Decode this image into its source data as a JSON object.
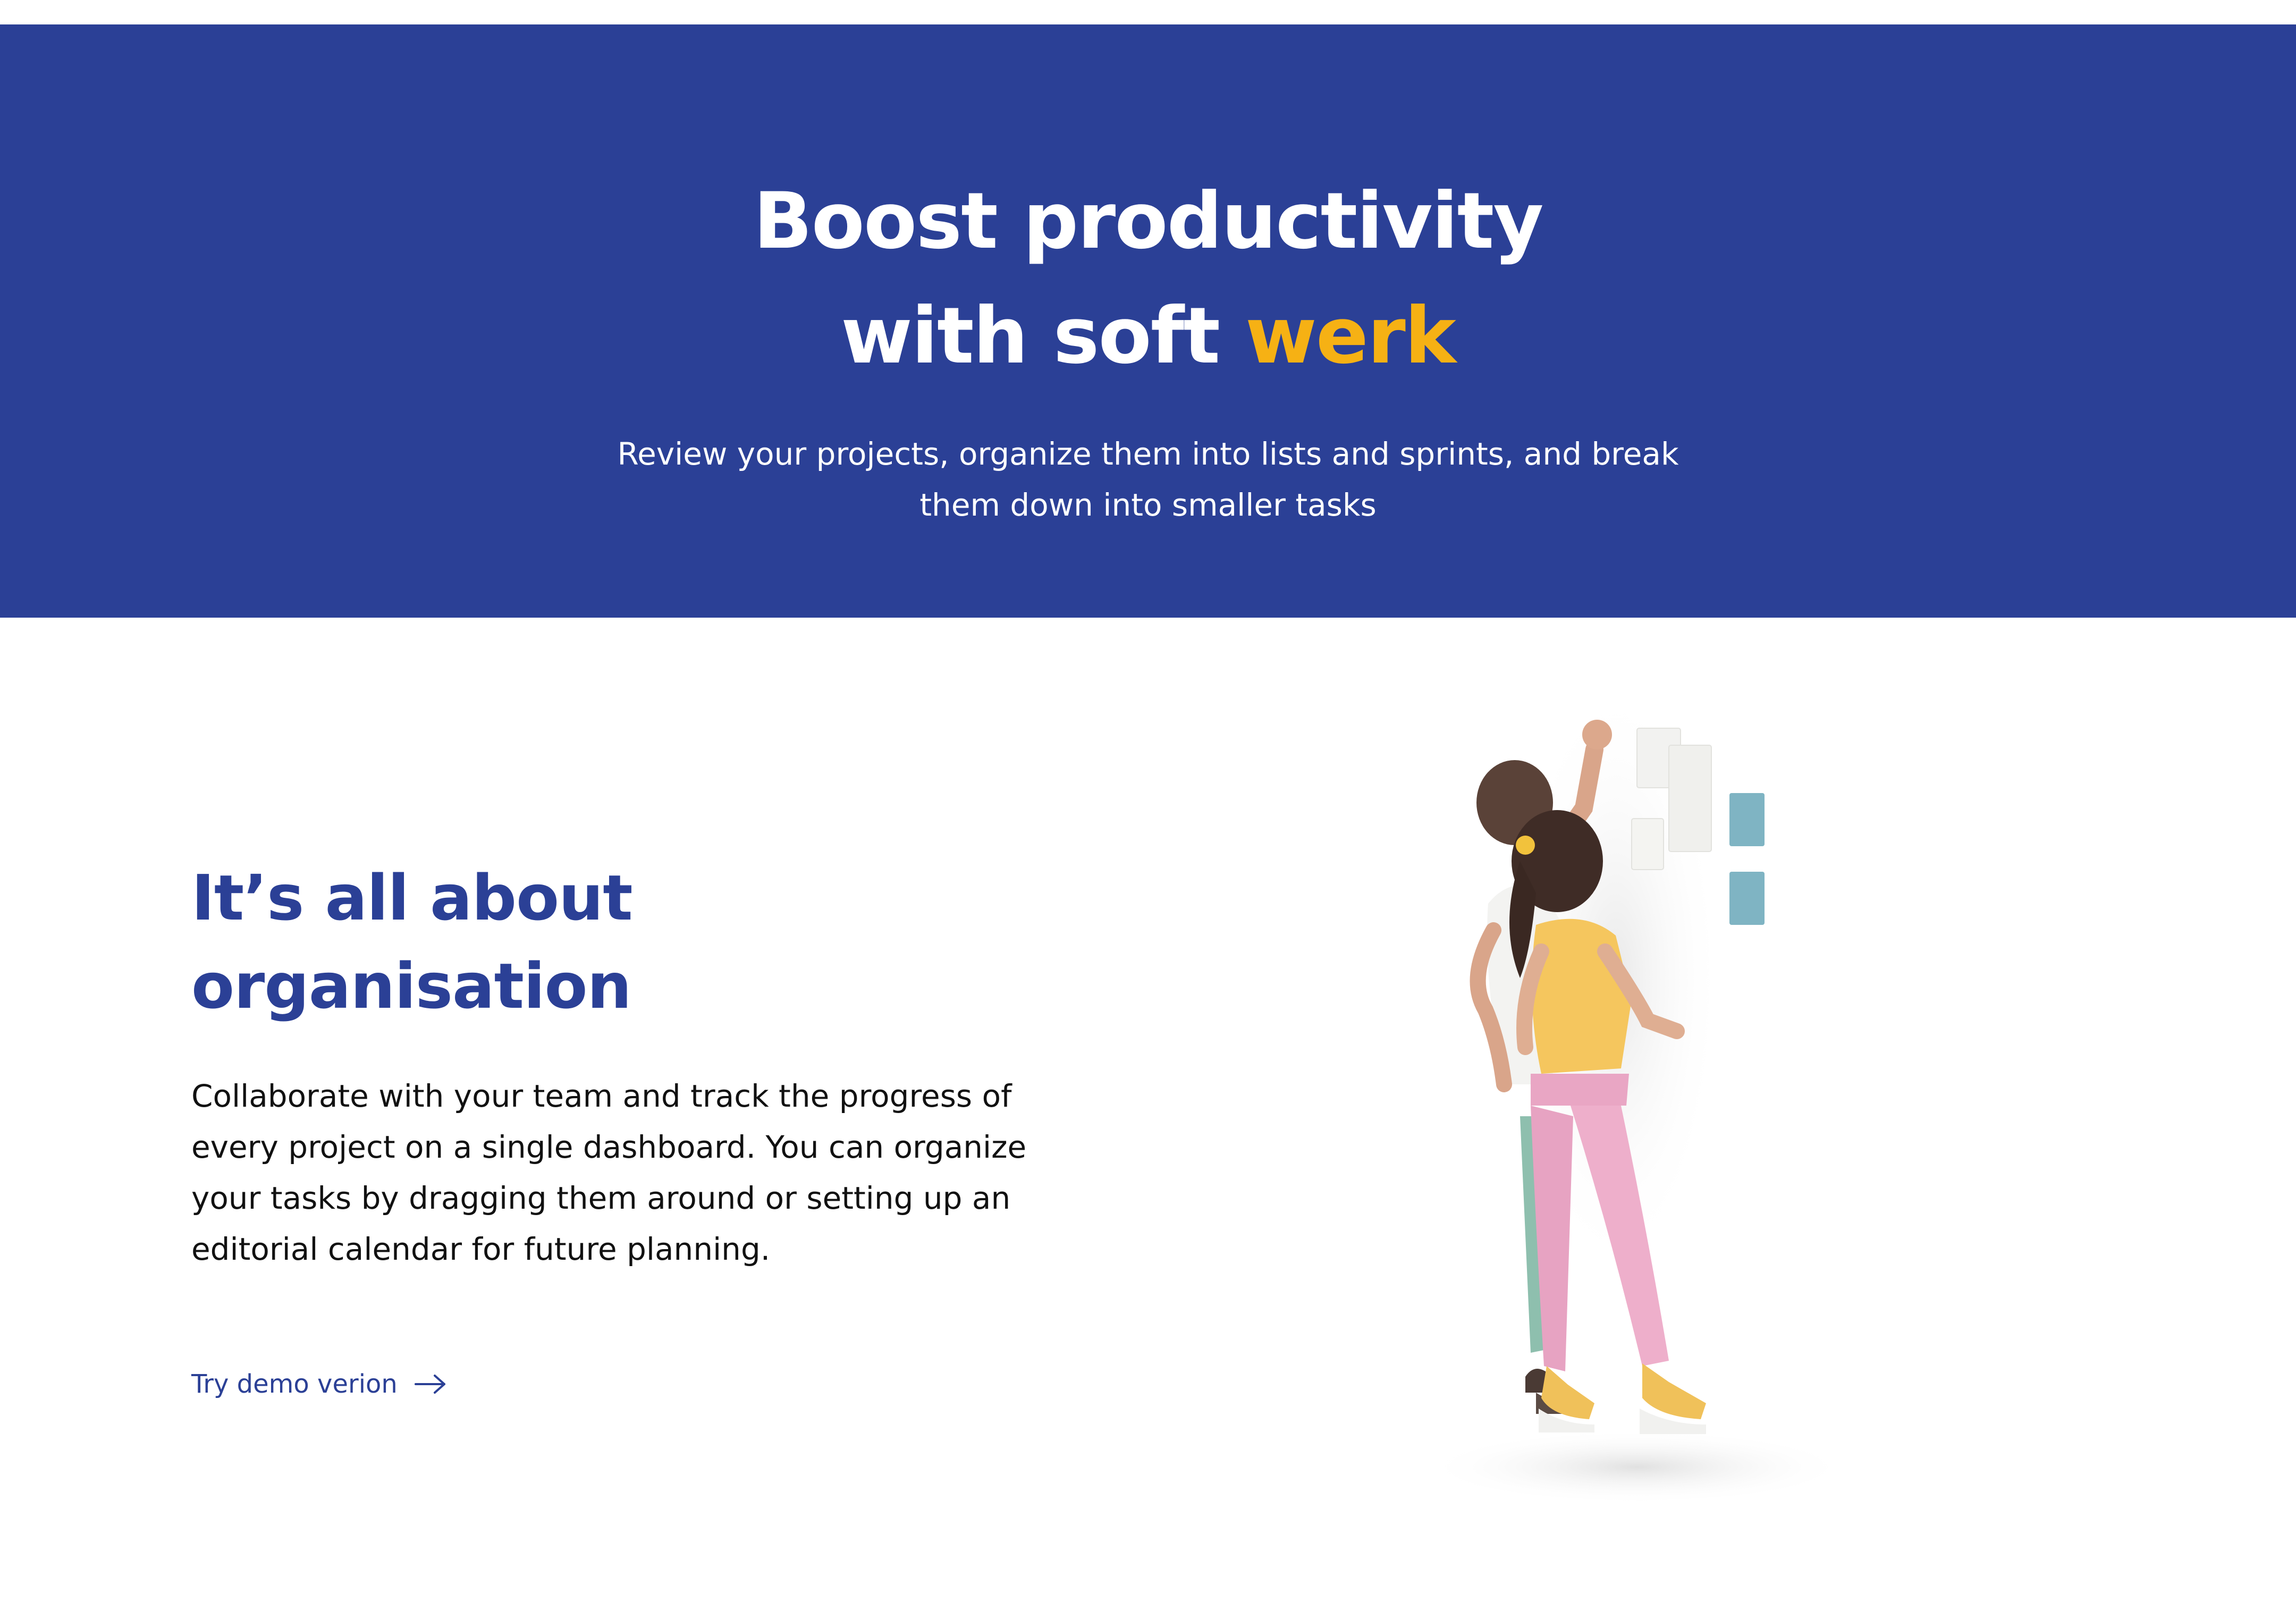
{
  "hero": {
    "title_line1": "Boost productivity",
    "title_line2_prefix": "with soft ",
    "title_line2_accent": "werk",
    "subtitle_line1": "Review your projects, organize them into lists and sprints, and break",
    "subtitle_line2": "them down into smaller tasks"
  },
  "section": {
    "title_line1": "It’s all about",
    "title_line2": "organisation",
    "body_lines": [
      "Collaborate with your team and track the progress of",
      "every project on a single dashboard. You can organize",
      "your tasks by dragging them around or setting up an",
      "editorial calendar for future planning."
    ],
    "cta_label": "Try demo verion",
    "cta_icon": "arrow-right-icon"
  },
  "illustration": {
    "icon": "people-sticky-notes-illustration"
  },
  "colors": {
    "brand_blue": "#2b4096",
    "accent_yellow": "#f6b114",
    "text_dark": "#111111",
    "background": "#ffffff"
  }
}
